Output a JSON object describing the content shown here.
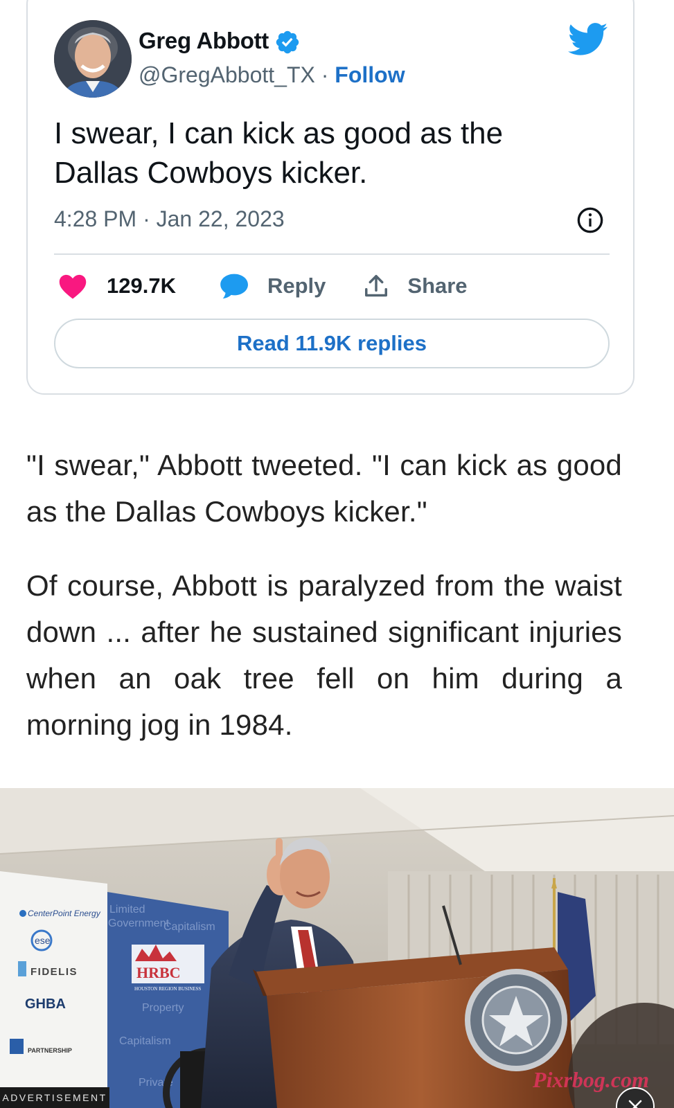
{
  "tweet": {
    "author_name": "Greg Abbott",
    "handle": "@GregAbbott_TX",
    "separator": "·",
    "follow_label": "Follow",
    "text": "I swear, I can kick as good as the Dallas Cowboys kicker.",
    "timestamp": "4:28 PM · Jan 22, 2023",
    "like_count": "129.7K",
    "reply_label": "Reply",
    "share_label": "Share",
    "read_replies_label": "Read 11.9K replies",
    "icons": {
      "verified": "verified-badge-icon",
      "brand": "twitter-bird-icon",
      "info": "info-icon",
      "like": "heart-icon",
      "reply": "reply-bubble-icon",
      "share": "share-upload-icon"
    },
    "colors": {
      "link": "#1d70c7",
      "heart": "#f91880",
      "reply_bubble": "#1d9bf0",
      "brand": "#1d9bf0"
    }
  },
  "article": {
    "paragraphs": [
      "\"I swear,\" Abbott tweeted. \"I can kick as good as the Dallas Cowboys kicker.\"",
      "Of course, Abbott is paralyzed from the waist down ... after he sustained significant injuries when an oak tree fell on him during a morning jog in 1984."
    ]
  },
  "photo": {
    "banner_logos": [
      "CenterPoint Energy",
      "ese",
      "FIDELIS",
      "GHBA",
      "PARTNERSHIP"
    ],
    "backdrop_words": [
      "Limited",
      "Government",
      "Capitalism",
      "Property",
      "Capitalism",
      "Private"
    ],
    "hrbc_logo": "HRBC",
    "hrbc_sub": "HOUSTON REGION BUSINESS",
    "ad_label": "ADVERTISEMENT",
    "watermark": "Pixrbog.com"
  }
}
